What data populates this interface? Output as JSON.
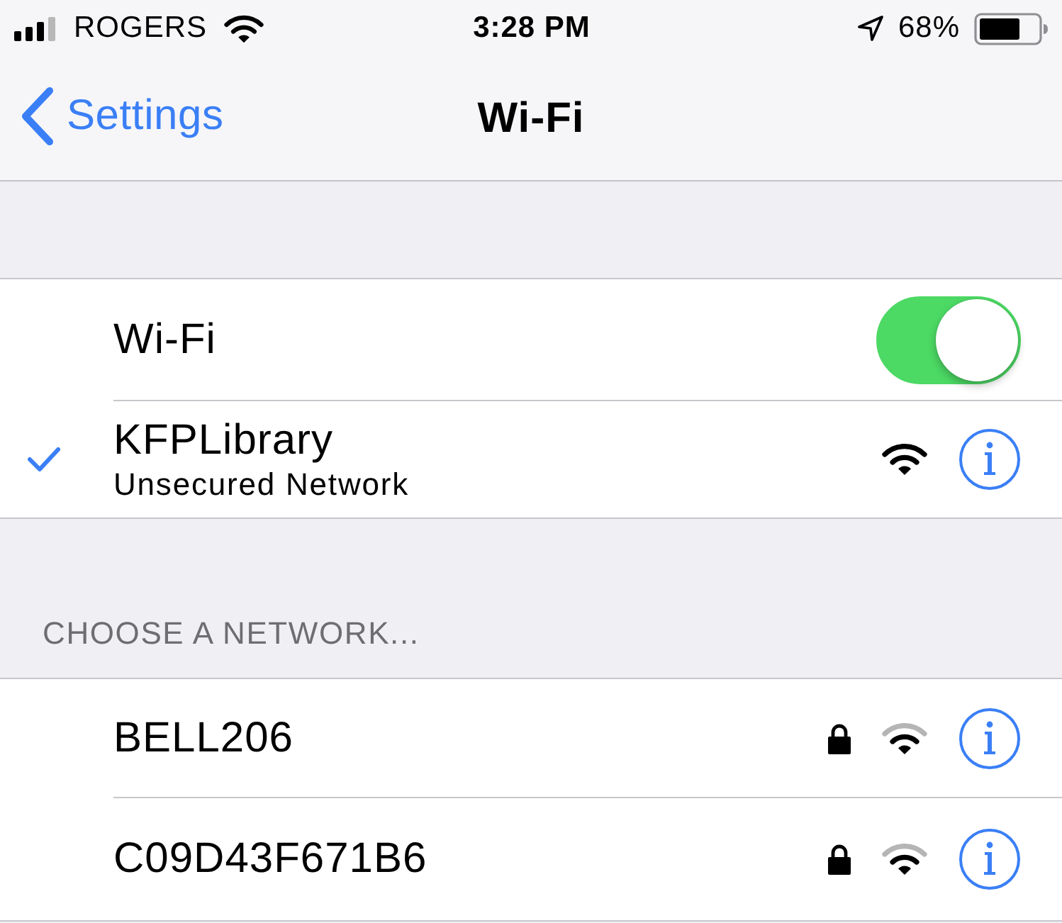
{
  "status_bar": {
    "carrier": "ROGERS",
    "time": "3:28 PM",
    "battery": "68%"
  },
  "nav_bar": {
    "back": "Settings",
    "title": "Wi-Fi"
  },
  "wifi_section": {
    "toggle": {
      "label": "Wi-Fi",
      "on": true
    },
    "current_network": {
      "name": "KFPLibrary",
      "subtitle": "Unsecured Network",
      "connected": true,
      "secured": false,
      "weak_signal": false
    }
  },
  "networks_section": {
    "header": "CHOOSE A NETWORK...",
    "networks": [
      {
        "name": "BELL206",
        "connected": false,
        "secured": true,
        "weak_signal": true
      },
      {
        "name": "C09D43F671B6",
        "connected": false,
        "secured": true,
        "weak_signal": true
      }
    ]
  }
}
